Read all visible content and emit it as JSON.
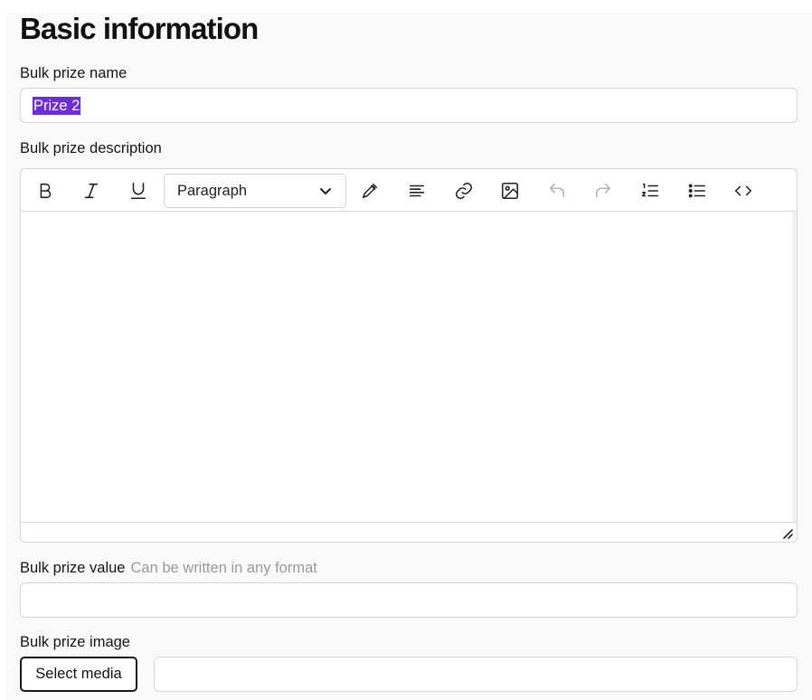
{
  "section": {
    "title": "Basic information"
  },
  "name_field": {
    "label": "Bulk prize name",
    "value": "Prize 2"
  },
  "description_field": {
    "label": "Bulk prize description",
    "format_select": {
      "selected": "Paragraph"
    },
    "toolbar_icons": [
      "bold-icon",
      "italic-icon",
      "underline-icon",
      "chevron-down-icon",
      "brush-icon",
      "align-left-icon",
      "link-icon",
      "image-icon",
      "undo-icon",
      "redo-icon",
      "ordered-list-icon",
      "unordered-list-icon",
      "code-icon",
      "resize-handle-icon"
    ],
    "value": ""
  },
  "value_field": {
    "label": "Bulk prize value",
    "hint": "Can be written in any format",
    "value": ""
  },
  "image_field": {
    "label": "Bulk prize image",
    "button_label": "Select media",
    "value": ""
  },
  "colors": {
    "selection_highlight": "#6c2fd6",
    "panel_background": "#f9f9f9",
    "border": "#d6d6d6"
  }
}
